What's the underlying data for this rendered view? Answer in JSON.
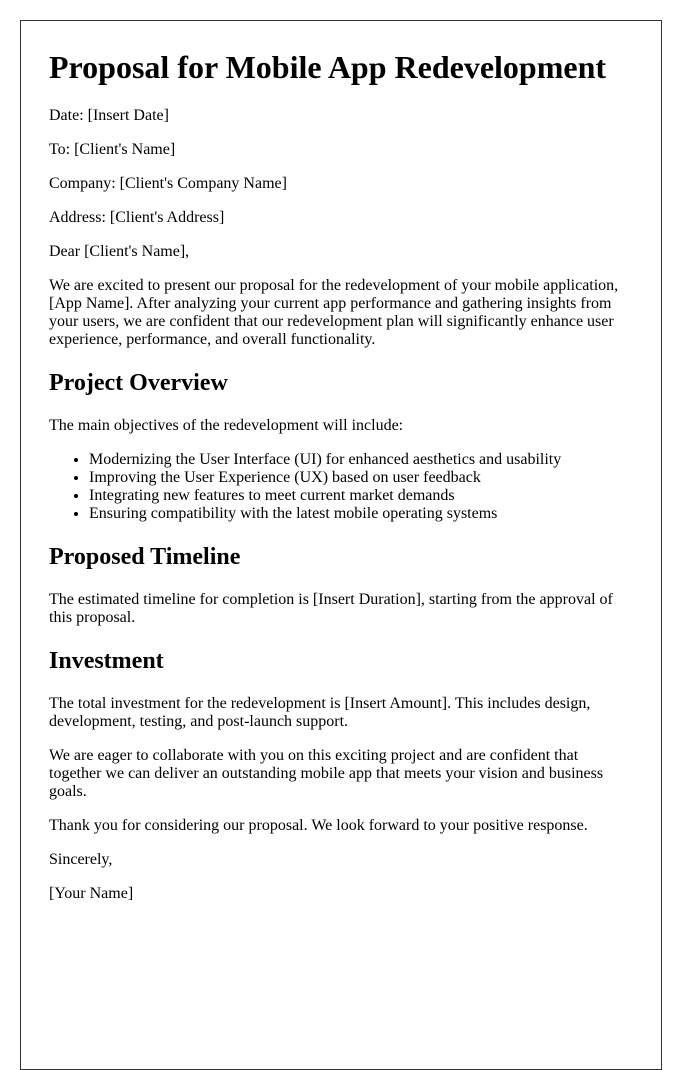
{
  "document": {
    "title": "Proposal for Mobile App Redevelopment",
    "header_fields": {
      "date": "Date: [Insert Date]",
      "to": "To: [Client's Name]",
      "company": "Company: [Client's Company Name]",
      "address": "Address: [Client's Address]"
    },
    "salutation": "Dear [Client's Name],",
    "intro": "We are excited to present our proposal for the redevelopment of your mobile application, [App Name]. After analyzing your current app performance and gathering insights from your users, we are confident that our redevelopment plan will significantly enhance user experience, performance, and overall functionality.",
    "sections": [
      {
        "heading": "Project Overview",
        "paragraph": "The main objectives of the redevelopment will include:",
        "bullets": [
          "Modernizing the User Interface (UI) for enhanced aesthetics and usability",
          "Improving the User Experience (UX) based on user feedback",
          "Integrating new features to meet current market demands",
          "Ensuring compatibility with the latest mobile operating systems"
        ]
      },
      {
        "heading": "Proposed Timeline",
        "paragraph": "The estimated timeline for completion is [Insert Duration], starting from the approval of this proposal."
      },
      {
        "heading": "Investment",
        "paragraph": "The total investment for the redevelopment is [Insert Amount]. This includes design, development, testing, and post-launch support."
      }
    ],
    "closing_paragraphs": [
      "We are eager to collaborate with you on this exciting project and are confident that together we can deliver an outstanding mobile app that meets your vision and business goals.",
      "Thank you for considering our proposal. We look forward to your positive response."
    ],
    "signoff": "Sincerely,",
    "signature": "[Your Name]"
  }
}
